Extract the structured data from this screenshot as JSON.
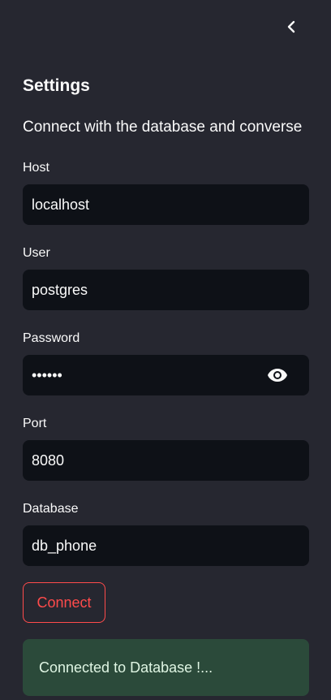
{
  "sidebar": {
    "title": "Settings",
    "subtitle": "Connect with the database and converse",
    "collapse_icon": "chevron-left-icon",
    "fields": {
      "host": {
        "label": "Host",
        "value": "localhost"
      },
      "user": {
        "label": "User",
        "value": "postgres"
      },
      "password": {
        "label": "Password",
        "value": "••••••",
        "toggle_icon": "eye-icon"
      },
      "port": {
        "label": "Port",
        "value": "8080"
      },
      "database": {
        "label": "Database",
        "value": "db_phone"
      }
    },
    "connect_button": {
      "label": "Connect"
    },
    "status": {
      "message": "Connected to Database !..."
    }
  },
  "colors": {
    "background": "#262730",
    "input_background": "#0e1117",
    "accent": "#ff4b4b",
    "success_background": "#2b4a3a"
  }
}
